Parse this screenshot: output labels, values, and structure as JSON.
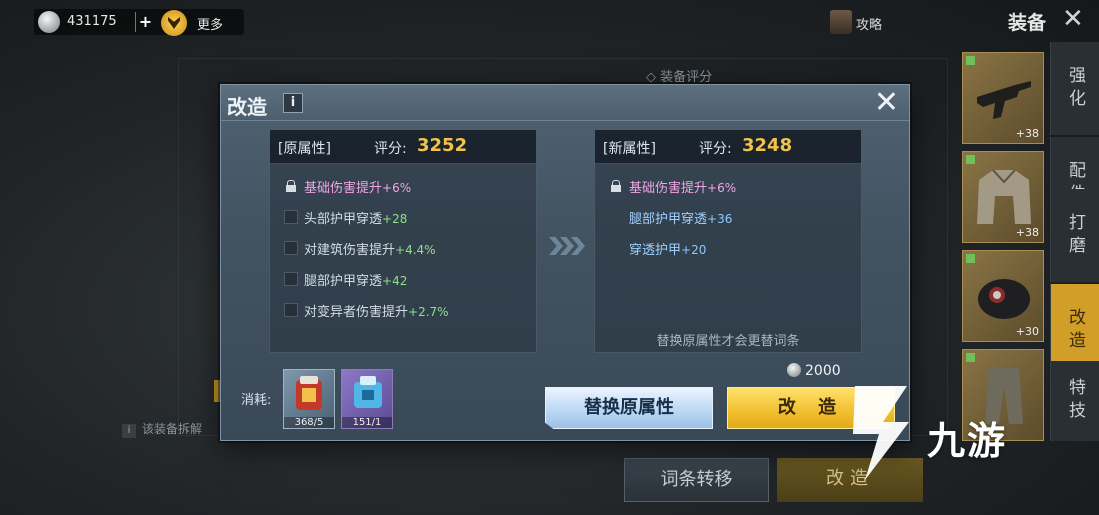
{
  "topbar": {
    "coin_value": "431175",
    "plus": "+",
    "more_label": "更多",
    "guide_label": "攻略",
    "page_title": "装备",
    "close_glyph": "✕"
  },
  "background": {
    "score_label": "◇ 装备评分",
    "note": "该装备拆解",
    "transfer_button": "词条转移",
    "remodel_button": "改造"
  },
  "side_tabs": [
    {
      "label": "强化",
      "active": false
    },
    {
      "label": "配件",
      "active": false
    },
    {
      "label": "打磨",
      "active": false
    },
    {
      "label": "改造",
      "active": true
    },
    {
      "label": "特技",
      "active": false
    }
  ],
  "equipment_slots": [
    {
      "count": "+38",
      "icon": "rifle-icon"
    },
    {
      "count": "+38",
      "icon": "jacket-icon"
    },
    {
      "count": "+30",
      "icon": "helmet-icon"
    },
    {
      "count": "",
      "icon": "pants-icon"
    }
  ],
  "dialog": {
    "title": "改造",
    "info_glyph": "i",
    "close_glyph": "✕",
    "original": {
      "tag": "[原属性]",
      "score_label": "评分:",
      "score": "3252",
      "rows": [
        {
          "name": "基础伤害提升",
          "value": "+6%",
          "locked": true
        },
        {
          "name": "头部护甲穿透",
          "value": "+28",
          "locked": false
        },
        {
          "name": "对建筑伤害提升",
          "value": "+4.4%",
          "locked": false
        },
        {
          "name": "腿部护甲穿透",
          "value": "+42",
          "locked": false
        },
        {
          "name": "对变异者伤害提升",
          "value": "+2.7%",
          "locked": false
        }
      ]
    },
    "new": {
      "tag": "[新属性]",
      "score_label": "评分:",
      "score": "3248",
      "rows": [
        {
          "name": "基础伤害提升",
          "value": "+6%",
          "locked": true
        },
        {
          "name": "腿部护甲穿透",
          "value": "+36",
          "locked": false
        },
        {
          "name": "穿透护甲",
          "value": "+20",
          "locked": false
        }
      ],
      "note": "替换原属性才会更替词条"
    },
    "cost_label": "消耗:",
    "materials": [
      {
        "count": "368/5",
        "icon": "red-kit-icon"
      },
      {
        "count": "151/1",
        "icon": "blue-kit-icon"
      }
    ],
    "price": "2000",
    "replace_button": "替换原属性",
    "remodel_button": "改 造"
  },
  "watermark": {
    "text": "九游"
  },
  "colors": {
    "accent_gold": "#f2bf2f",
    "score_gold": "#f2c24a",
    "attr_pink": "#f0a6e6",
    "attr_green": "#8fe08a",
    "attr_blue": "#8fc7ff"
  }
}
